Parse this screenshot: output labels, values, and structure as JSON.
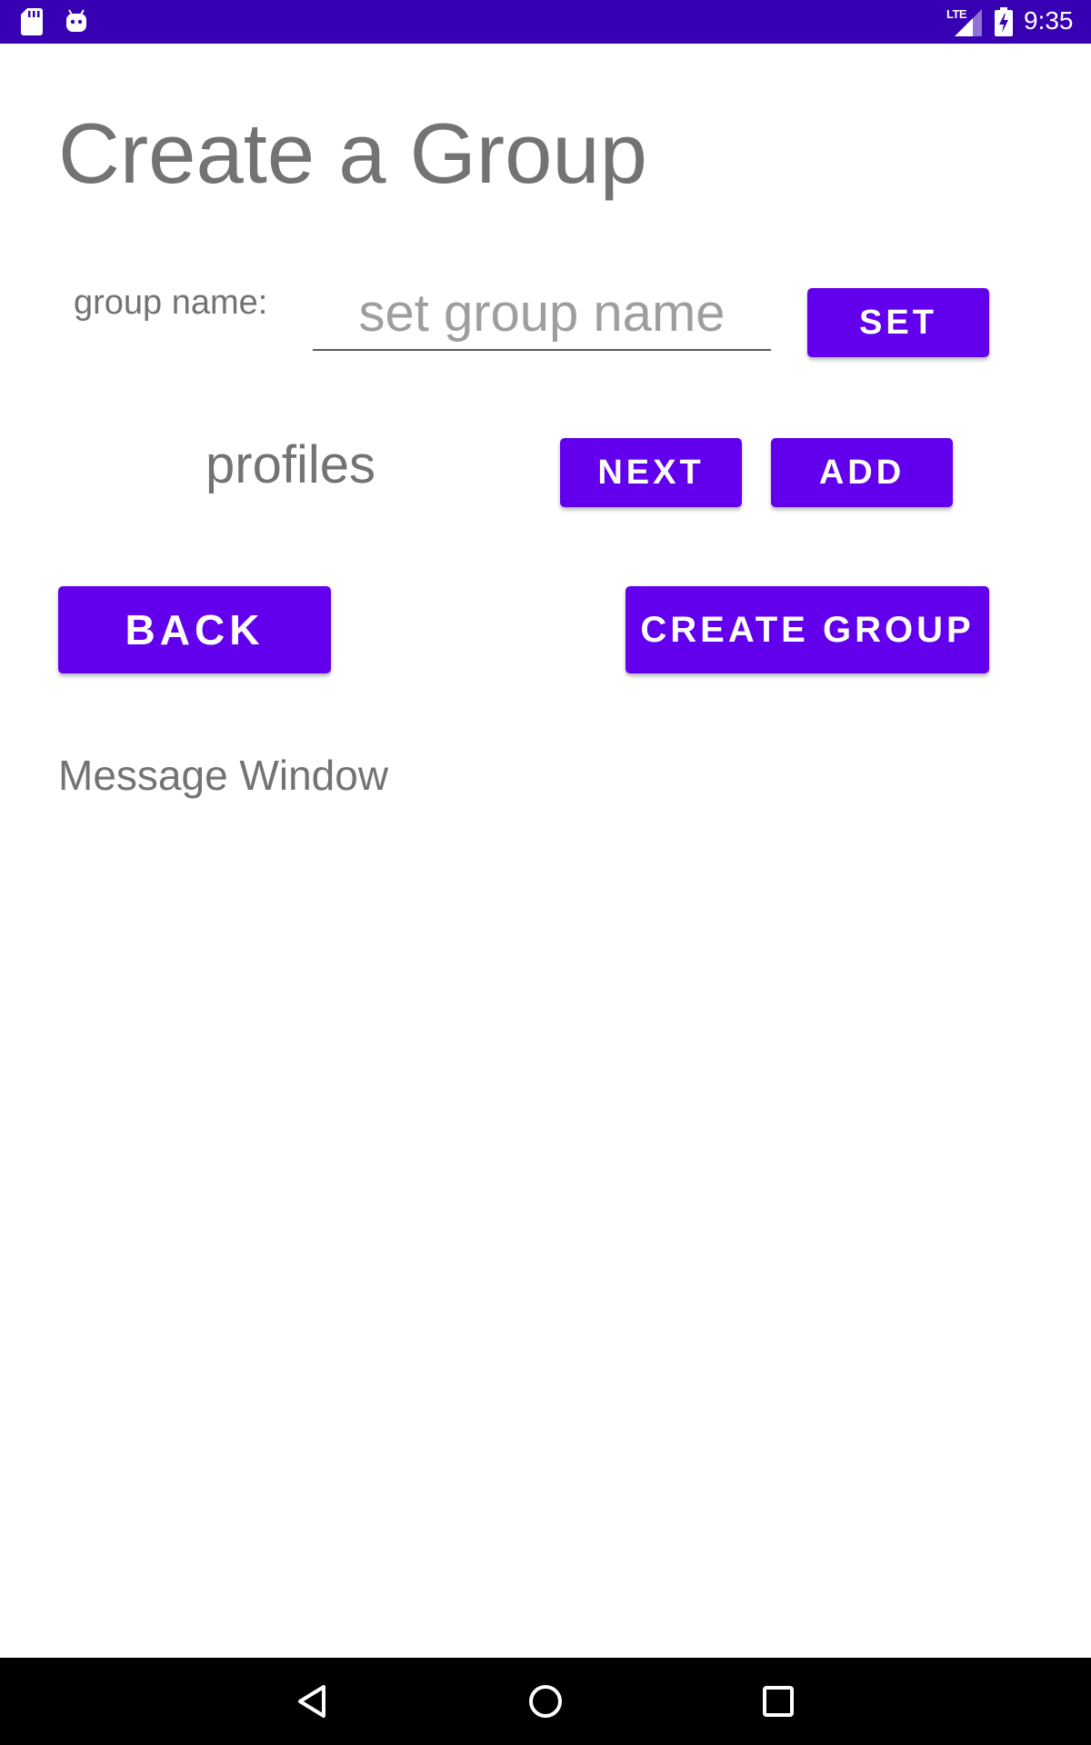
{
  "status_bar": {
    "network": "LTE",
    "time": "9:35",
    "icons": [
      "sd-card-icon",
      "android-icon",
      "signal-icon",
      "battery-charging-icon"
    ]
  },
  "page": {
    "title": "Create a Group"
  },
  "group_name": {
    "label": "group name:",
    "placeholder": "set group name",
    "value": "",
    "set_button": "SET"
  },
  "profiles": {
    "label": "profiles",
    "next_button": "NEXT",
    "add_button": "ADD"
  },
  "actions": {
    "back_button": "BACK",
    "create_button": "CREATE GROUP"
  },
  "message_window": {
    "text": "Message Window"
  },
  "nav_bar": {
    "icons": [
      "back-icon",
      "home-icon",
      "recents-icon"
    ]
  },
  "colors": {
    "status_bar": "#3700b3",
    "primary": "#6200ee",
    "text_gray": "#737373",
    "nav_bar": "#000000"
  }
}
